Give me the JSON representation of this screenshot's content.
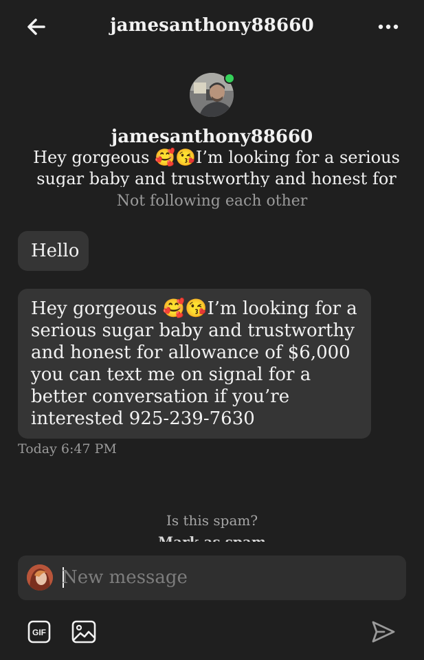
{
  "header": {
    "title": "jamesanthony88660",
    "back_icon": "arrow-left-icon",
    "more_icon": "more-horizontal-icon"
  },
  "profile": {
    "name": "jamesanthony88660",
    "bio": "Hey gorgeous 🥰😘I’m looking for a serious sugar baby and trustworthy and honest for allowance of..",
    "follow_status": "Not following each other",
    "online_color": "#35d15a"
  },
  "messages": [
    {
      "text": "Hello"
    },
    {
      "text": "Hey gorgeous 🥰😘I’m looking for a serious sugar baby and trustworthy and honest for allowance of $6,000 you can text me on signal for a better conversation if you’re interested 925-239-7630"
    }
  ],
  "timestamp": "Today 6:47 PM",
  "spam": {
    "question": "Is this spam?",
    "action": "Mark as spam"
  },
  "composer": {
    "placeholder": "New message"
  },
  "toolbar": {
    "gif_label": "GIF",
    "image_icon": "image-icon",
    "send_icon": "send-icon"
  },
  "colors": {
    "background": "#1f1f1f",
    "bubble": "#353535",
    "composer": "#2f2f2f",
    "muted_text": "#9a9a9a"
  }
}
